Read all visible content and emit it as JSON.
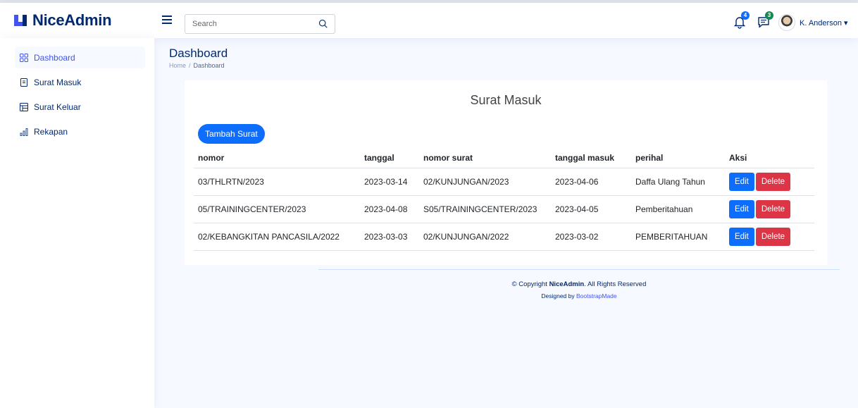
{
  "header": {
    "logo_text": "NiceAdmin",
    "search_placeholder": "Search",
    "notifications_count": "4",
    "messages_count": "3",
    "user_name": "K. Anderson ▾",
    "colors": {
      "brand": "#012970",
      "accent": "#4154f1",
      "notif_badge": "#0d6efd",
      "msg_badge": "#198754"
    }
  },
  "sidebar": {
    "items": [
      {
        "label": "Dashboard",
        "icon": "grid-icon",
        "active": true
      },
      {
        "label": "Surat Masuk",
        "icon": "file-icon",
        "active": false
      },
      {
        "label": "Surat Keluar",
        "icon": "table-icon",
        "active": false
      },
      {
        "label": "Rekapan",
        "icon": "bar-chart-icon",
        "active": false
      }
    ]
  },
  "pagetitle": {
    "title": "Dashboard",
    "breadcrumb_home": "Home",
    "breadcrumb_sep": "/",
    "breadcrumb_current": "Dashboard"
  },
  "card": {
    "title": "Surat Masuk",
    "add_button": "Tambah Surat",
    "columns": [
      "nomor",
      "tanggal",
      "nomor surat",
      "tanggal masuk",
      "perihal",
      "Aksi"
    ],
    "rows": [
      {
        "nomor": "03/THLRTN/2023",
        "tanggal": "2023-03-14",
        "nomor_surat": "02/KUNJUNGAN/2023",
        "tanggal_masuk": "2023-04-06",
        "perihal": "Daffa Ulang Tahun"
      },
      {
        "nomor": "05/TRAININGCENTER/2023",
        "tanggal": "2023-04-08",
        "nomor_surat": "S05/TRAININGCENTER/2023",
        "tanggal_masuk": "2023-04-05",
        "perihal": "Pemberitahuan"
      },
      {
        "nomor": "02/KEBANGKITAN PANCASILA/2022",
        "tanggal": "2023-03-03",
        "nomor_surat": "02/KUNJUNGAN/2022",
        "tanggal_masuk": "2023-03-02",
        "perihal": "PEMBERITAHUAN"
      }
    ],
    "edit_label": "Edit",
    "delete_label": "Delete",
    "colors": {
      "primary": "#0d6efd",
      "danger": "#dc3545"
    }
  },
  "footer": {
    "copyright_prefix": "© Copyright ",
    "copyright_brand": "NiceAdmin",
    "copyright_suffix": ". All Rights Reserved",
    "designed_by": "Designed by ",
    "designer": "BootstrapMade"
  }
}
